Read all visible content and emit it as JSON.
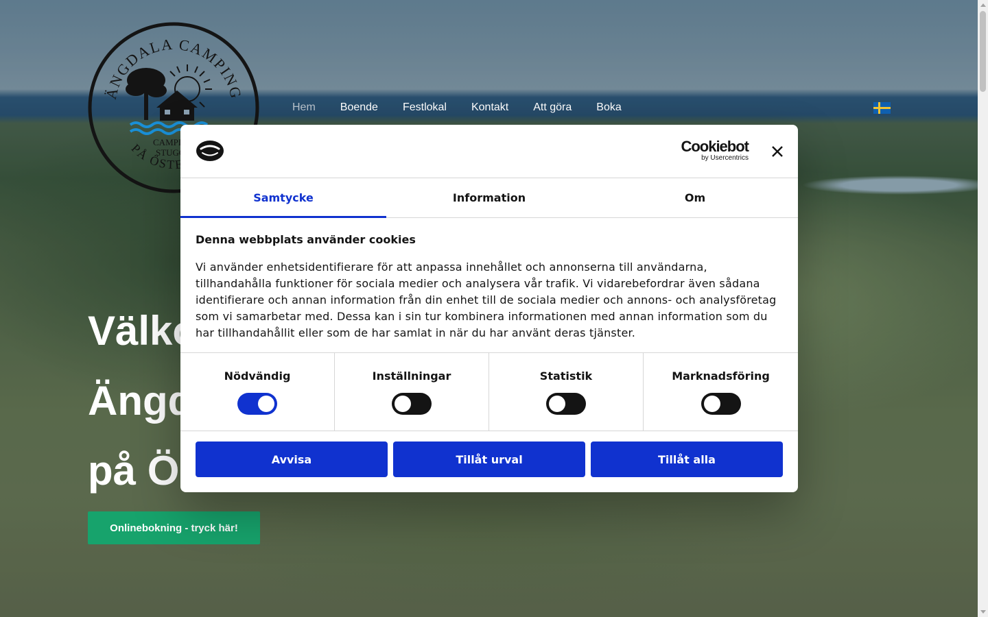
{
  "site": {
    "logo": {
      "text_top": "ÄNGDALA CAMPING",
      "text_mid1": "CAMPING",
      "text_mid2": "STUGOR",
      "text_bottom": "PÅ ÖSTERLEN",
      "icon": "camping-logo-tree-house-sun-waves"
    },
    "nav": [
      {
        "label": "Hem",
        "active": true
      },
      {
        "label": "Boende"
      },
      {
        "label": "Festlokal"
      },
      {
        "label": "Kontakt"
      },
      {
        "label": "Att göra"
      },
      {
        "label": "Boka"
      }
    ],
    "language_flag": "swedish-flag-icon",
    "hero": {
      "line1": "Välkommen till",
      "line2": "Ängdala Camping",
      "line3": "på Österlen",
      "cta_label": "Onlinebokning - tryck här!",
      "cta_color": "#17a36c"
    }
  },
  "cookie_dialog": {
    "brand_name": "Cookiebot",
    "brand_sub": "by Usercentrics",
    "close_icon": "close-icon",
    "tabs": [
      {
        "label": "Samtycke",
        "active": true
      },
      {
        "label": "Information"
      },
      {
        "label": "Om"
      }
    ],
    "heading": "Denna webbplats använder cookies",
    "body": "Vi använder enhetsidentifierare för att anpassa innehållet och annonserna till användarna, tillhandahålla funktioner för sociala medier och analysera vår trafik. Vi vidarebefordrar även sådana identifierare och annan information från din enhet till de sociala medier och annons- och analysföretag som vi samarbetar med. Dessa kan i sin tur kombinera informationen med annan information som du har tillhandahållit eller som de har samlat in när du har använt deras tjänster.",
    "toggles": [
      {
        "label": "Nödvändig",
        "on": true
      },
      {
        "label": "Inställningar",
        "on": false
      },
      {
        "label": "Statistik",
        "on": false
      },
      {
        "label": "Marknadsföring",
        "on": false
      }
    ],
    "buttons": {
      "reject": "Avvisa",
      "allow_selection": "Tillåt urval",
      "allow_all": "Tillåt alla"
    },
    "accent_color": "#1032cf"
  }
}
